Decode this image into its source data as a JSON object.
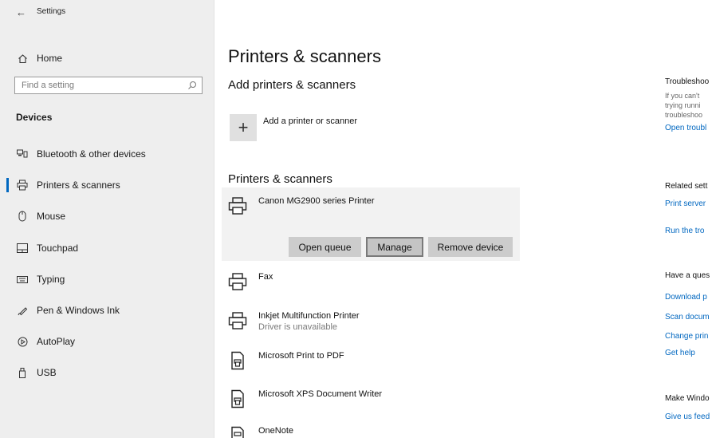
{
  "window": {
    "title": "Settings",
    "back_glyph": "←"
  },
  "sidebar": {
    "home": "Home",
    "search_placeholder": "Find a setting",
    "group": "Devices",
    "items": [
      {
        "label": "Bluetooth & other devices",
        "icon": "bluetooth-devices-icon"
      },
      {
        "label": "Printers & scanners",
        "icon": "printer-icon",
        "selected": true
      },
      {
        "label": "Mouse",
        "icon": "mouse-icon"
      },
      {
        "label": "Touchpad",
        "icon": "touchpad-icon"
      },
      {
        "label": "Typing",
        "icon": "keyboard-icon"
      },
      {
        "label": "Pen & Windows Ink",
        "icon": "pen-icon"
      },
      {
        "label": "AutoPlay",
        "icon": "autoplay-icon"
      },
      {
        "label": "USB",
        "icon": "usb-icon"
      }
    ]
  },
  "main": {
    "title": "Printers & scanners",
    "add_heading": "Add printers & scanners",
    "add_button_glyph": "+",
    "add_label": "Add a printer or scanner",
    "list_heading": "Printers & scanners",
    "printers": [
      {
        "name": "Canon MG2900 series Printer",
        "sub": ""
      },
      {
        "name": "Fax",
        "sub": ""
      },
      {
        "name": "Inkjet Multifunction Printer",
        "sub": "Driver is unavailable"
      },
      {
        "name": "Microsoft Print to PDF",
        "sub": ""
      },
      {
        "name": "Microsoft XPS Document Writer",
        "sub": ""
      },
      {
        "name": "OneNote",
        "sub": ""
      }
    ],
    "buttons": {
      "open_queue": "Open queue",
      "manage": "Manage",
      "remove": "Remove device"
    }
  },
  "right": {
    "troubleshoot_heading": "Troubleshoo",
    "troubleshoot_text": [
      "If you can't",
      "trying runni",
      "troubleshoo"
    ],
    "troubleshoot_link": "Open troubl",
    "related_heading": "Related sett",
    "related_links": [
      "Print server",
      "Run the tro"
    ],
    "question_heading": "Have a ques",
    "question_links": [
      "Download p",
      "Scan docum",
      "Change prin",
      "Get help"
    ],
    "make_heading": "Make Windo",
    "make_link": "Give us feed"
  },
  "colors": {
    "accent": "#0067c0",
    "sidebar_bg": "#eeeeee",
    "selected_bg": "#f2f2f2",
    "button_bg": "#cccccc"
  }
}
